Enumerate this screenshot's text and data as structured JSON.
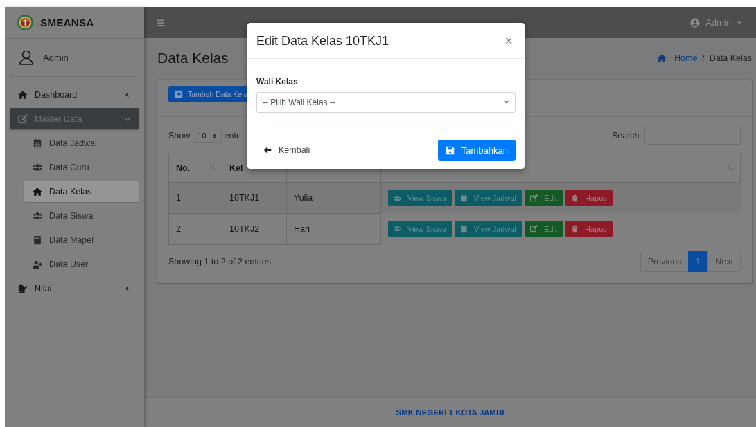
{
  "brand": {
    "name": "SMEANSA"
  },
  "user_panel": {
    "name": "Admin"
  },
  "sidebar": {
    "items": [
      {
        "label": "Dashboard",
        "selected": false,
        "expanded": false
      },
      {
        "label": "Master Data",
        "selected": true,
        "expanded": true,
        "children": [
          {
            "label": "Data Jadwal",
            "selected": false
          },
          {
            "label": "Data Guru",
            "selected": false
          },
          {
            "label": "Data Kelas",
            "selected": true
          },
          {
            "label": "Data Siswa",
            "selected": false
          },
          {
            "label": "Data Mapel",
            "selected": false
          },
          {
            "label": "Data User",
            "selected": false
          }
        ]
      },
      {
        "label": "Nilai",
        "selected": false,
        "expanded": false
      }
    ]
  },
  "topbar": {
    "user": "Admin"
  },
  "page": {
    "title": "Data Kelas",
    "breadcrumb": [
      "Home",
      "Data Kelas"
    ],
    "breadcrumb_separator": "/"
  },
  "card": {
    "add_button": "Tambah Data Kela",
    "length": {
      "label_before": "Show",
      "value": "10",
      "label_after": "entri"
    },
    "search": {
      "label": "Search:"
    },
    "table": {
      "columns": [
        {
          "label": "No."
        },
        {
          "label": "Kel"
        }
      ],
      "rows": [
        {
          "cells": [
            "1",
            "10TKJ1",
            "Yulia"
          ],
          "actions": [
            {
              "label": "View Siswa",
              "kind": "info"
            },
            {
              "label": "View Jadwal",
              "kind": "info"
            },
            {
              "label": "Edit",
              "kind": "success"
            },
            {
              "label": "Hapus",
              "kind": "danger"
            }
          ]
        },
        {
          "cells": [
            "2",
            "10TKJ2",
            "Hari"
          ],
          "actions": [
            {
              "label": "View Siswa",
              "kind": "info"
            },
            {
              "label": "View Jadwal",
              "kind": "info"
            },
            {
              "label": "Edit",
              "kind": "success"
            },
            {
              "label": "Hapus",
              "kind": "danger"
            }
          ]
        }
      ]
    },
    "info": "Showing 1 to 2 of 2 entries",
    "pagination": [
      {
        "label": "Previous",
        "selected": false
      },
      {
        "label": "1",
        "selected": true
      },
      {
        "label": "Next",
        "selected": false
      }
    ]
  },
  "footer": {
    "text": "SMK NEGERI 1 KOTA JAMBI"
  },
  "modal": {
    "title": "Edit Data Kelas 10TKJ1",
    "close": "×",
    "field": {
      "label": "Wali Kelas",
      "value": "-- Pilih Wali Kelas --"
    },
    "back_button": "Kembali",
    "submit_button": "Tambahkan"
  }
}
